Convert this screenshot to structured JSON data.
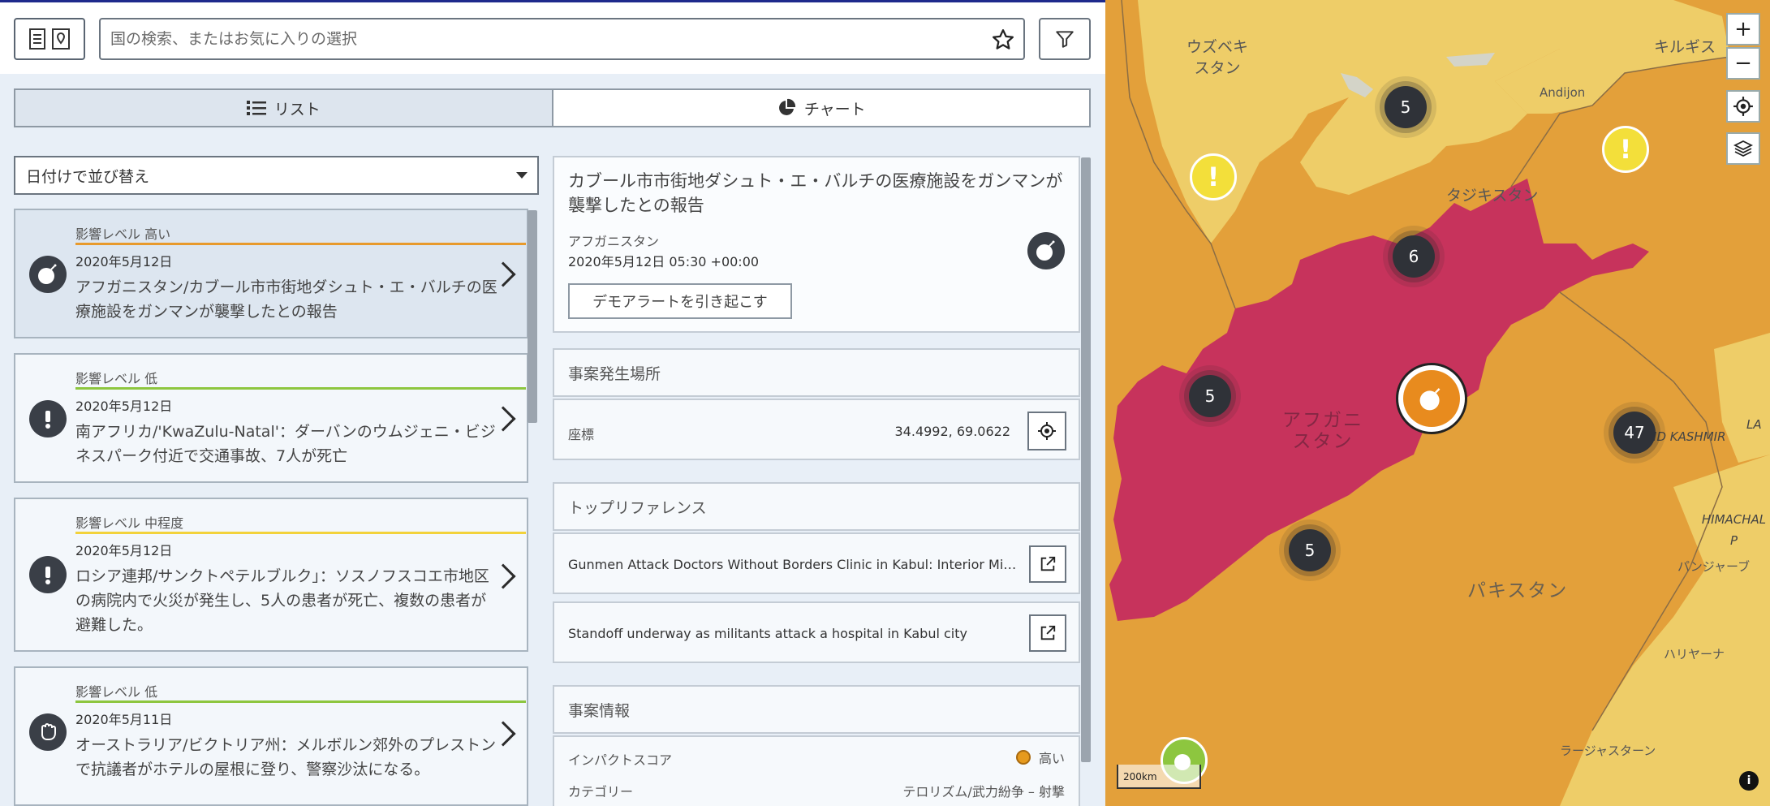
{
  "search": {
    "placeholder": "国の検索、またはお気に入りの選択"
  },
  "tabs": [
    {
      "label": "リスト"
    },
    {
      "label": "チャート"
    }
  ],
  "sort": {
    "selected": "日付けで並び替え"
  },
  "list": {
    "items": [
      {
        "level": "影響レベル 高い",
        "level_color": "#e89a2c",
        "date": "2020年5月12日",
        "title": "アフガニスタン/カブール市市街地ダシュト・エ・バルチの医療施設をガンマンが襲撃したとの報告",
        "icon": "bomb-icon"
      },
      {
        "level": "影響レベル 低",
        "level_color": "#8dc63f",
        "date": "2020年5月12日",
        "title": "南アフリカ/'KwaZulu-Natal'：ダーバンのウムジェニ・ビジネスパーク付近で交通事故、7人が死亡",
        "icon": "exclamation-icon"
      },
      {
        "level": "影響レベル 中程度",
        "level_color": "#f2d23b",
        "date": "2020年5月12日",
        "title": "ロシア連邦/サンクトペテルブルク」：ソスノフスコエ市地区の病院内で火災が発生し、5人の患者が死亡、複数の患者が避難した。",
        "icon": "exclamation-icon"
      },
      {
        "level": "影響レベル 低",
        "level_color": "#8dc63f",
        "date": "2020年5月11日",
        "title": "オーストラリア/ビクトリア州：メルボルン郊外のプレストンで抗議者がホテルの屋根に登り、警察沙汰になる。",
        "icon": "protest-fist-icon"
      }
    ]
  },
  "detail": {
    "title": "カブール市市街地ダシュト・エ・バルチの医療施設をガンマンが襲撃したとの報告",
    "country": "アフガニスタン",
    "datetime": "2020年5月12日 05:30 +00:00",
    "demo_button": "デモアラートを引き起こす",
    "location_header": "事案発生場所",
    "coord_label": "座標",
    "coord_value": "34.4992, 69.0622",
    "refs_header": "トップリファレンス",
    "refs": [
      "Gunmen Attack Doctors Without Borders Clinic in Kabul: Interior Ministry Sources",
      "Standoff underway as militants attack a hospital in Kabul city"
    ],
    "info_header": "事案情報",
    "impact_label": "インパクトスコア",
    "impact_value": "高い",
    "impact_color": "#e69a1d",
    "category_label": "カテゴリー",
    "category_value": "テロリズム/武力紛争 – 射撃"
  },
  "map": {
    "labels": {
      "uzbek": "ウズベキ\nスタン",
      "kyrgyz": "キルギス",
      "andijon": "Andijon",
      "tajik": "タジキスタン",
      "afghan": "アフガニ\nスタン",
      "pakistan": "パキスタン",
      "kashmir": "AND KASHMIR",
      "himachal": "HIMACHAL P",
      "punjab": "パンジャーブ",
      "haryana": "ハリヤーナ",
      "rajasthan": "ラージャスターン",
      "la": "LA"
    },
    "clusters": [
      "5",
      "6",
      "5",
      "47",
      "5"
    ],
    "alert_glyph": "!",
    "zoom_in": "+",
    "zoom_out": "−",
    "scale": "200km",
    "info": "i"
  }
}
